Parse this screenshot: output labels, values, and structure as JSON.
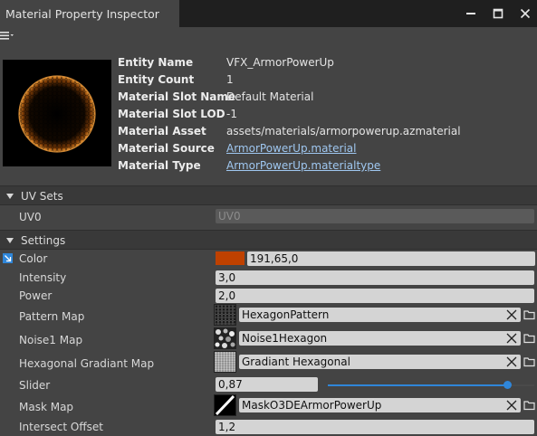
{
  "window": {
    "title": "Material Property Inspector",
    "controls": [
      "minimize-icon",
      "maximize-icon",
      "close-icon"
    ]
  },
  "menu_icon": "hamburger-menu-icon",
  "header": {
    "preview_icon": "material-preview-sphere",
    "fields": [
      {
        "label": "Entity Name",
        "value": "VFX_ArmorPowerUp",
        "link": false
      },
      {
        "label": "Entity Count",
        "value": "1",
        "link": false
      },
      {
        "label": "Material Slot Name",
        "value": "Default Material",
        "link": false
      },
      {
        "label": "Material Slot LOD",
        "value": "-1",
        "link": false
      },
      {
        "label": "Material Asset",
        "value": "assets/materials/armorpowerup.azmaterial",
        "link": false
      },
      {
        "label": "Material Source",
        "value": "ArmorPowerUp.material",
        "link": true
      },
      {
        "label": "Material Type",
        "value": "ArmorPowerUp.materialtype",
        "link": true
      }
    ]
  },
  "uv_sets": {
    "title": "UV Sets",
    "label": "UV0",
    "value": "UV0"
  },
  "settings": {
    "title": "Settings",
    "color": {
      "label": "Color",
      "value": "191,65,0",
      "swatch": "#bf4100"
    },
    "intensity": {
      "label": "Intensity",
      "value": "3,0"
    },
    "power": {
      "label": "Power",
      "value": "2,0"
    },
    "pattern_map": {
      "label": "Pattern Map",
      "value": "HexagonPattern"
    },
    "noise1_map": {
      "label": "Noise1 Map",
      "value": "Noise1Hexagon"
    },
    "hex_gradient_map": {
      "label": "Hexagonal Gradiant Map",
      "value": "Gradiant Hexagonal"
    },
    "slider": {
      "label": "Slider",
      "value": "0,87",
      "fraction": 0.87
    },
    "mask_map": {
      "label": "Mask Map",
      "value": "MaskO3DEArmorPowerUp"
    },
    "intersect_offset": {
      "label": "Intersect Offset",
      "value": "1,2"
    }
  },
  "colors": {
    "accent": "#2f86d9",
    "link": "#9fc7f0",
    "color_swatch": "#bf4100",
    "glow": "#e07a1a"
  }
}
